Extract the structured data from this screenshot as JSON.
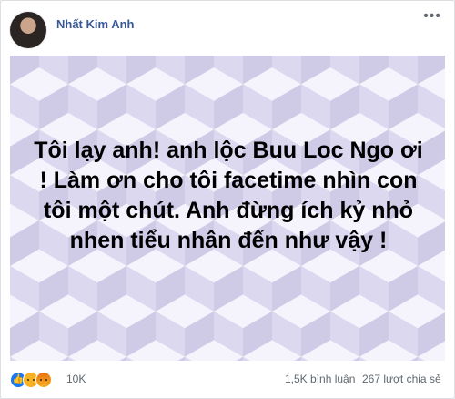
{
  "post": {
    "author": "Nhất Kim Anh",
    "more_label": "•••",
    "text": "Tôi lạy anh! anh lộc Buu Loc Ngo ơi ! Làm ơn cho tôi facetime nhìn con tôi một chút. Anh đừng ích kỷ nhỏ nhen tiểu nhân đến như vậy !",
    "background_colors": [
      "#ebe8f8",
      "#cfcbe6",
      "#dcd8f0",
      "#f5f3fc"
    ]
  },
  "footer": {
    "reaction_icons": [
      "like-icon",
      "sad-icon",
      "angry-icon"
    ],
    "reaction_count": "10K",
    "comments": "1,5K bình luận",
    "shares": "267 lượt chia sẻ"
  }
}
